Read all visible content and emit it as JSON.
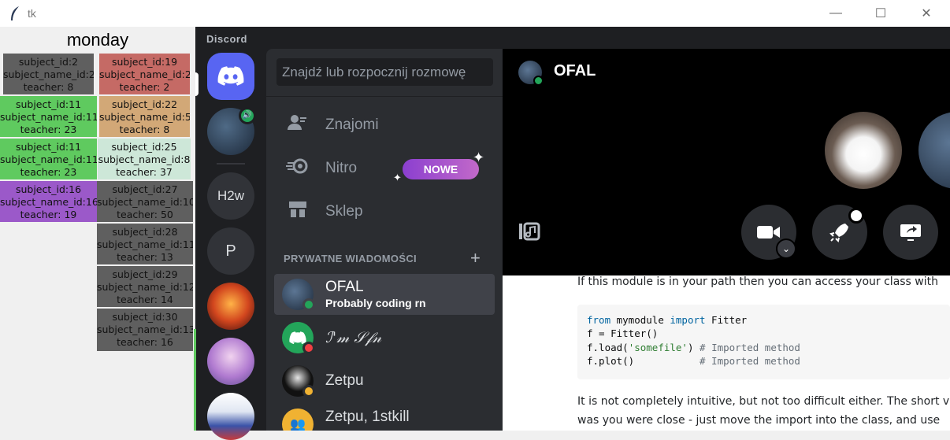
{
  "window": {
    "title": "tk",
    "controls": {
      "minimize": "—",
      "maximize": "☐",
      "close": "✕"
    }
  },
  "schedule": {
    "day": "monday",
    "left_column": [
      {
        "l1": "subject_id:2",
        "l2": "subject_name_id:2",
        "l3": "teacher: 8",
        "color": "#5f5f5f"
      },
      {
        "l1": "subject_id:11",
        "l2": "subject_name_id:11",
        "l3": "teacher: 23",
        "color": "#5fca5f"
      },
      {
        "l1": "subject_id:11",
        "l2": "subject_name_id:11",
        "l3": "teacher: 23",
        "color": "#5fca5f"
      },
      {
        "l1": "subject_id:16",
        "l2": "subject_name_id:16",
        "l3": "teacher: 19",
        "color": "#9b59c9"
      }
    ],
    "right_column": [
      {
        "l1": "subject_id:19",
        "l2": "subject_name_id:2",
        "l3": "teacher: 2",
        "color": "#c56a65"
      },
      {
        "l1": "subject_id:22",
        "l2": "subject_name_id:5",
        "l3": "teacher: 8",
        "color": "#d2a877"
      },
      {
        "l1": "subject_id:25",
        "l2": "subject_name_id:8",
        "l3": "teacher: 37",
        "color": "#cde7d8"
      },
      {
        "l1": "subject_id:27",
        "l2": "subject_name_id:10",
        "l3": "teacher: 50",
        "color": "#5f5f5f"
      },
      {
        "l1": "subject_id:28",
        "l2": "subject_name_id:11",
        "l3": "teacher: 13",
        "color": "#5f5f5f"
      },
      {
        "l1": "subject_id:29",
        "l2": "subject_name_id:12",
        "l3": "teacher: 14",
        "color": "#5f5f5f"
      },
      {
        "l1": "subject_id:30",
        "l2": "subject_name_id:13",
        "l3": "teacher: 16",
        "color": "#5f5f5f"
      }
    ]
  },
  "discord": {
    "app_label": "Discord",
    "servers": [
      {
        "name": "discord-home",
        "label": ""
      },
      {
        "name": "server-avatar",
        "label": ""
      },
      {
        "name": "server-h2w",
        "label": "H2w"
      },
      {
        "name": "server-p",
        "label": "P"
      },
      {
        "name": "server-phoenix",
        "label": ""
      },
      {
        "name": "server-anime",
        "label": ""
      },
      {
        "name": "server-photo",
        "label": ""
      }
    ],
    "search_placeholder": "Znajdź lub rozpocznij rozmowę",
    "nav": {
      "friends": "Znajomi",
      "nitro": "Nitro",
      "nitro_badge": "NOWE",
      "shop": "Sklep"
    },
    "dm_header": "PRYWATNE WIADOMOŚCI",
    "dm_add": "+",
    "dms": [
      {
        "name": "OFAL",
        "status": "Probably coding rn"
      },
      {
        "name": "ℐ'𝓂 𝒮𝒻𝓃",
        "status": ""
      },
      {
        "name": "Zetpu",
        "status": ""
      },
      {
        "name": "Zetpu, 1stkill",
        "status": ""
      }
    ],
    "call": {
      "name": "OFAL"
    },
    "colors": {
      "blurple": "#5865f2",
      "online": "#23a55a",
      "dnd": "#f23f43"
    }
  },
  "webpage": {
    "line_top": "If this module is in your path then you can access your class with",
    "code": {
      "l1_kw": "from",
      "l1_mod": " mymodule ",
      "l1_kw2": "import",
      "l1_cls": " Fitter",
      "l2": "f = Fitter()",
      "l3_a": "f.load(",
      "l3_str": "'somefile'",
      "l3_b": ") ",
      "l3_cm": "# Imported method",
      "l4_a": "f.plot()           ",
      "l4_cm": "# Imported method"
    },
    "line_bottom1": "It is not completely intuitive, but not too difficult either. The short versi",
    "line_bottom2": "was you were close - just move the import into the class, and use"
  }
}
